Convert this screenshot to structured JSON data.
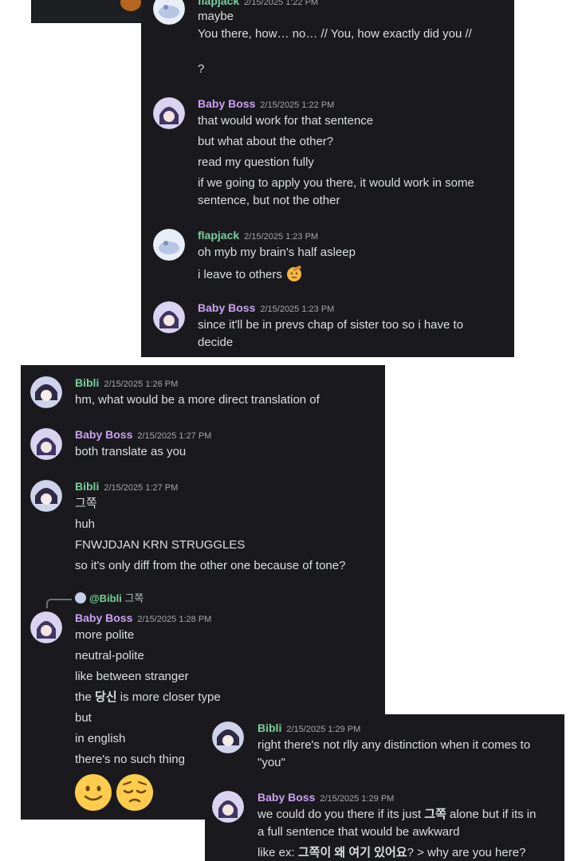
{
  "panel1": {
    "partial_header": {
      "name": "flapjack",
      "time": "2/15/2025 1:22 PM"
    },
    "partial_lines": [
      "maybe",
      "You there, how… no… // You, how exactly did you //",
      "?"
    ],
    "messages": [
      {
        "name": "Baby Boss",
        "time": "2/15/2025 1:22 PM",
        "lines": [
          "that would work for that sentence",
          "but what about the other?",
          "read my question fully",
          "if we going to apply you there, it would work in some",
          "sentence, but not the other"
        ]
      },
      {
        "name": "flapjack",
        "time": "2/15/2025 1:23 PM",
        "lines": [
          "oh myb my brain's half asleep",
          "i leave to others"
        ]
      },
      {
        "name": "Baby Boss",
        "time": "2/15/2025 1:23 PM",
        "lines": [
          "since it'll be in prevs chap of sister too so i have to",
          "decide"
        ]
      }
    ]
  },
  "panel2": {
    "messages": [
      {
        "name": "Bibli",
        "time": "2/15/2025 1:26 PM",
        "lines": [
          "hm, what would be a more direct translation of"
        ]
      },
      {
        "name": "Baby Boss",
        "time": "2/15/2025 1:27 PM",
        "lines": [
          "both translate as you"
        ]
      },
      {
        "name": "Bibli",
        "time": "2/15/2025 1:27 PM",
        "lines": [
          "그쪽",
          "huh",
          "FNWJDJAN KRN STRUGGLES",
          "so it's only diff from the other one because of tone?"
        ]
      },
      {
        "name": "Baby Boss",
        "time": "2/15/2025 1:28 PM",
        "reply": {
          "mention": "@Bibli",
          "text": "그쪽"
        },
        "lines": [
          "more polite",
          "neutral-polite",
          "like between stranger",
          "the ",
          "당신",
          " is more closer type",
          "but",
          "in english",
          "there's no such thing"
        ],
        "emojis": [
          "slightly-smiling-face-emoji",
          "pensive-face-emoji"
        ]
      }
    ]
  },
  "panel3": {
    "messages": [
      {
        "name": "Bibli",
        "time": "2/15/2025 1:29 PM",
        "lines": [
          "right there's not rlly any distinction when it comes to",
          "\"you\""
        ]
      },
      {
        "name": "Baby Boss",
        "time": "2/15/2025 1:29 PM",
        "lines": [
          "we could do you there if its just ",
          "그쪽",
          " alone but if its in",
          "a full sentence that would be awkward",
          "like ex: ",
          "그쪽이 왜 여기 있어요",
          "? > why are you here?"
        ]
      }
    ]
  }
}
